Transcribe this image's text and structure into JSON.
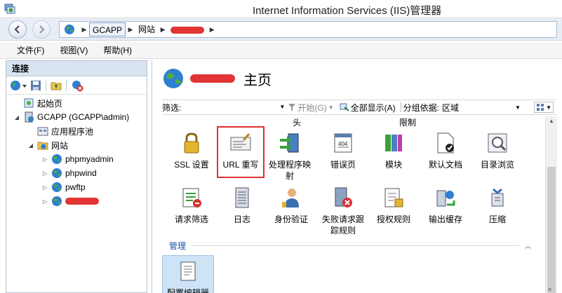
{
  "window": {
    "title": "Internet Information Services (IIS)管理器"
  },
  "address": {
    "crumbs": [
      "GCAPP",
      "网站"
    ]
  },
  "menu": {
    "items": [
      "文件(F)",
      "视图(V)",
      "帮助(H)"
    ]
  },
  "connections": {
    "header": "连接",
    "tree": [
      {
        "label": "起始页"
      },
      {
        "label": "GCAPP (GCAPP\\admin)"
      },
      {
        "label": "应用程序池"
      },
      {
        "label": "网站"
      },
      {
        "label": "phpmyadmin"
      },
      {
        "label": "phpwind"
      },
      {
        "label": "pwftp"
      }
    ]
  },
  "content": {
    "title": "主页",
    "filter": {
      "label": "筛选:",
      "start": "开始(G)",
      "show_all": "全部显示(A)",
      "group_by_label": "分组依据:",
      "group_by_value": "区域"
    },
    "top_labels": [
      "头",
      "限制"
    ],
    "features_row1": [
      {
        "label": "SSL 设置",
        "icon": "lock-icon"
      },
      {
        "label": "URL 重写",
        "icon": "url-rewrite-icon"
      },
      {
        "label": "处理程序映射",
        "icon": "handler-mapping-icon"
      },
      {
        "label": "错误页",
        "icon": "error-page-icon"
      },
      {
        "label": "模块",
        "icon": "modules-icon"
      },
      {
        "label": "默认文档",
        "icon": "default-document-icon"
      },
      {
        "label": "目录浏览",
        "icon": "directory-browsing-icon"
      }
    ],
    "features_row2": [
      {
        "label": "请求筛选",
        "icon": "request-filtering-icon"
      },
      {
        "label": "日志",
        "icon": "logging-icon"
      },
      {
        "label": "身份验证",
        "icon": "authentication-icon"
      },
      {
        "label": "失败请求跟踪规则",
        "icon": "failed-request-tracing-icon"
      },
      {
        "label": "授权规则",
        "icon": "authorization-icon"
      },
      {
        "label": "输出缓存",
        "icon": "output-caching-icon"
      },
      {
        "label": "压缩",
        "icon": "compression-icon"
      }
    ],
    "section": {
      "label": "管理"
    },
    "features_row3": [
      {
        "label": "配置编辑器",
        "icon": "configuration-editor-icon"
      }
    ]
  },
  "colors": {
    "highlight": "#e03131",
    "selection": "#cde4f7",
    "section_link": "#1a55a6"
  }
}
